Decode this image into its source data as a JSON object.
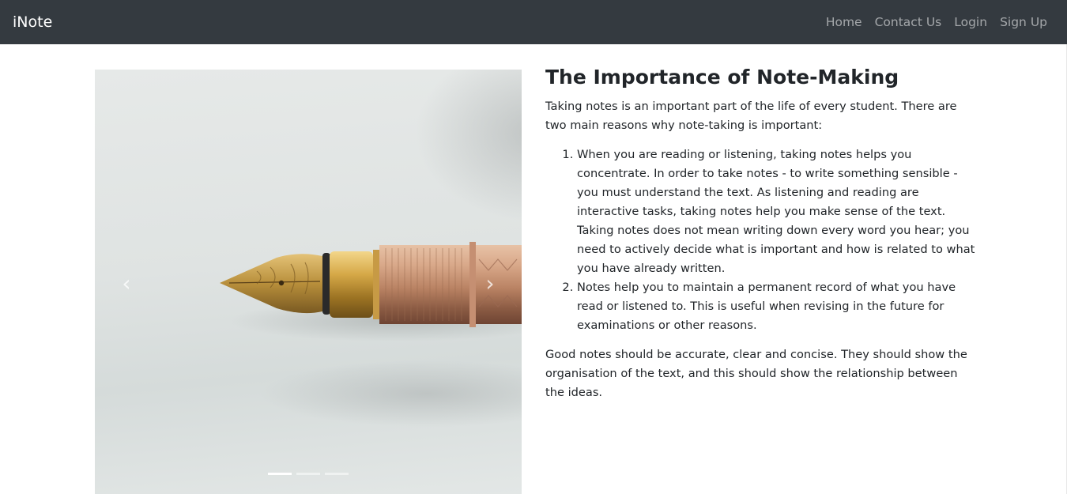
{
  "navbar": {
    "brand": "iNote",
    "links": [
      "Home",
      "Contact Us",
      "Login",
      "Sign Up"
    ]
  },
  "carousel": {
    "image_alt": "fountain-pen",
    "prev_icon": "chevron-left-icon",
    "next_icon": "chevron-right-icon",
    "prev_glyph": "‹",
    "next_glyph": "›",
    "slide_count": 3,
    "active_slide": 1
  },
  "article": {
    "title": "The Importance of Note-Making",
    "intro": "Taking notes is an important part of the life of every student. There are two main reasons why note-taking is important:",
    "reasons": [
      "When you are reading or listening, taking notes helps you concentrate. In order to take notes - to write something sensible - you must understand the text. As listening and reading are interactive tasks, taking notes help you make sense of the text. Taking notes does not mean writing down every word you hear; you need to actively decide what is important and how is related to what you have already written.",
      "Notes help you to maintain a permanent record of what you have read or listened to. This is useful when revising in the future for examinations or other reasons."
    ],
    "conclusion": "Good notes should be accurate, clear and concise. They should show the organisation of the text, and this should show the relationship between the ideas."
  },
  "colors": {
    "navbar_bg": "#343a40",
    "brand": "#ffffff",
    "nav_link": "#9a9da0",
    "text": "#212529"
  }
}
